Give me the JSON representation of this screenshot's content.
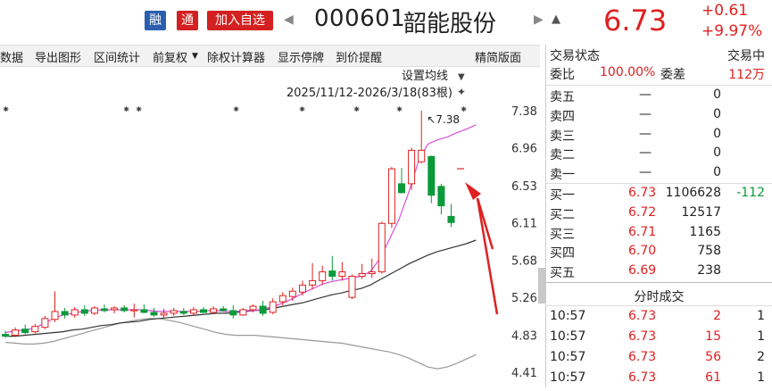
{
  "header": {
    "badge_rong": "融",
    "badge_tong": "通",
    "add_watchlist": "加入自选",
    "code": "000601",
    "name": "韶能股份",
    "price": "6.73",
    "change": "+0.61",
    "change_pct": "+9.97%",
    "nav_prev_icon": "chevron-left-icon",
    "nav_next_icon": "chevron-right-icon",
    "alert_icon": "bell-icon",
    "up_color": "#e02020"
  },
  "toolbar": {
    "items": [
      "数据",
      "导出图形",
      "区间统计",
      "前复权",
      "除权计算器",
      "显示停牌",
      "到价提醒"
    ],
    "restore_dropdown_icon": "caret-down-icon",
    "layout_label": "精简版面"
  },
  "chart": {
    "ma_setting": "设置均线",
    "range_label": "2025/11/12-2026/3/18(83根)",
    "pin_icon": "pin-icon",
    "high_label": "7.38"
  },
  "chart_data": {
    "type": "candlestick",
    "y_ticks": [
      "7.38",
      "6.96",
      "6.53",
      "6.11",
      "5.68",
      "5.26",
      "4.83",
      "4.41"
    ],
    "ylim": [
      4.41,
      7.38
    ],
    "annotated_high": 7.38,
    "candles": [
      {
        "o": 4.84,
        "h": 4.88,
        "l": 4.8,
        "c": 4.82
      },
      {
        "o": 4.83,
        "h": 4.92,
        "l": 4.81,
        "c": 4.89
      },
      {
        "o": 4.9,
        "h": 4.95,
        "l": 4.84,
        "c": 4.86
      },
      {
        "o": 4.87,
        "h": 4.96,
        "l": 4.85,
        "c": 4.93
      },
      {
        "o": 4.92,
        "h": 5.05,
        "l": 4.9,
        "c": 5.02
      },
      {
        "o": 5.01,
        "h": 5.33,
        "l": 4.98,
        "c": 5.1
      },
      {
        "o": 5.1,
        "h": 5.14,
        "l": 5.02,
        "c": 5.06
      },
      {
        "o": 5.06,
        "h": 5.15,
        "l": 5.03,
        "c": 5.12
      },
      {
        "o": 5.12,
        "h": 5.17,
        "l": 5.05,
        "c": 5.08
      },
      {
        "o": 5.08,
        "h": 5.16,
        "l": 5.06,
        "c": 5.14
      },
      {
        "o": 5.13,
        "h": 5.18,
        "l": 5.09,
        "c": 5.11
      },
      {
        "o": 5.12,
        "h": 5.16,
        "l": 5.08,
        "c": 5.14
      },
      {
        "o": 5.14,
        "h": 5.17,
        "l": 5.09,
        "c": 5.11
      },
      {
        "o": 5.11,
        "h": 5.19,
        "l": 5.03,
        "c": 5.12
      },
      {
        "o": 5.12,
        "h": 5.18,
        "l": 5.08,
        "c": 5.09
      },
      {
        "o": 5.09,
        "h": 5.14,
        "l": 5.04,
        "c": 5.06
      },
      {
        "o": 5.06,
        "h": 5.13,
        "l": 5.02,
        "c": 5.08
      },
      {
        "o": 5.08,
        "h": 5.14,
        "l": 5.05,
        "c": 5.11
      },
      {
        "o": 5.1,
        "h": 5.14,
        "l": 5.06,
        "c": 5.08
      },
      {
        "o": 5.08,
        "h": 5.15,
        "l": 5.05,
        "c": 5.12
      },
      {
        "o": 5.12,
        "h": 5.15,
        "l": 5.08,
        "c": 5.09
      },
      {
        "o": 5.09,
        "h": 5.16,
        "l": 5.07,
        "c": 5.13
      },
      {
        "o": 5.13,
        "h": 5.16,
        "l": 5.1,
        "c": 5.11
      },
      {
        "o": 5.11,
        "h": 5.17,
        "l": 5.02,
        "c": 5.06
      },
      {
        "o": 5.06,
        "h": 5.14,
        "l": 5.05,
        "c": 5.12
      },
      {
        "o": 5.12,
        "h": 5.18,
        "l": 5.09,
        "c": 5.16
      },
      {
        "o": 5.16,
        "h": 5.22,
        "l": 5.05,
        "c": 5.08
      },
      {
        "o": 5.09,
        "h": 5.25,
        "l": 5.07,
        "c": 5.21
      },
      {
        "o": 5.21,
        "h": 5.32,
        "l": 5.17,
        "c": 5.28
      },
      {
        "o": 5.27,
        "h": 5.37,
        "l": 5.22,
        "c": 5.33
      },
      {
        "o": 5.32,
        "h": 5.45,
        "l": 5.28,
        "c": 5.4
      },
      {
        "o": 5.4,
        "h": 5.65,
        "l": 5.35,
        "c": 5.45
      },
      {
        "o": 5.45,
        "h": 5.62,
        "l": 5.4,
        "c": 5.55
      },
      {
        "o": 5.56,
        "h": 5.73,
        "l": 5.45,
        "c": 5.5
      },
      {
        "o": 5.5,
        "h": 5.66,
        "l": 5.45,
        "c": 5.55
      },
      {
        "o": 5.26,
        "h": 5.52,
        "l": 5.24,
        "c": 5.5
      },
      {
        "o": 5.5,
        "h": 5.64,
        "l": 5.47,
        "c": 5.53
      },
      {
        "o": 5.53,
        "h": 5.7,
        "l": 5.48,
        "c": 5.55
      },
      {
        "o": 5.55,
        "h": 6.12,
        "l": 5.53,
        "c": 6.1
      },
      {
        "o": 6.1,
        "h": 6.74,
        "l": 6.05,
        "c": 6.72
      },
      {
        "o": 6.55,
        "h": 6.73,
        "l": 6.44,
        "c": 6.45
      },
      {
        "o": 6.55,
        "h": 6.96,
        "l": 6.48,
        "c": 6.93
      },
      {
        "o": 6.8,
        "h": 7.38,
        "l": 6.78,
        "c": 6.93
      },
      {
        "o": 6.86,
        "h": 6.87,
        "l": 6.33,
        "c": 6.42
      },
      {
        "o": 6.52,
        "h": 6.55,
        "l": 6.2,
        "c": 6.3
      },
      {
        "o": 6.18,
        "h": 6.32,
        "l": 6.06,
        "c": 6.11
      }
    ],
    "ma_fast": [
      4.86,
      4.88,
      4.89,
      4.91,
      4.96,
      5.02,
      5.06,
      5.08,
      5.1,
      5.11,
      5.12,
      5.12,
      5.12,
      5.12,
      5.12,
      5.11,
      5.1,
      5.1,
      5.1,
      5.1,
      5.1,
      5.11,
      5.11,
      5.1,
      5.1,
      5.11,
      5.11,
      5.13,
      5.16,
      5.2,
      5.25,
      5.31,
      5.36,
      5.41,
      5.44,
      5.46,
      5.48,
      5.5,
      5.55,
      5.7,
      5.92,
      6.15,
      6.45,
      6.8,
      7.0,
      7.05,
      7.08,
      7.13,
      7.17,
      7.22
    ],
    "ma_slow": [
      4.82,
      4.82,
      4.83,
      4.84,
      4.85,
      4.86,
      4.87,
      4.89,
      4.9,
      4.92,
      4.94,
      4.95,
      4.97,
      4.98,
      4.99,
      5.01,
      5.02,
      5.03,
      5.04,
      5.05,
      5.06,
      5.07,
      5.08,
      5.08,
      5.09,
      5.1,
      5.11,
      5.12,
      5.14,
      5.16,
      5.18,
      5.2,
      5.23,
      5.26,
      5.29,
      5.31,
      5.34,
      5.36,
      5.4,
      5.46,
      5.52,
      5.58,
      5.64,
      5.69,
      5.74,
      5.78,
      5.81,
      5.84,
      5.87,
      5.91
    ],
    "ma_lower": [
      4.75,
      4.74,
      4.73,
      4.73,
      4.74,
      4.76,
      4.79,
      4.82,
      4.85,
      4.88,
      4.91,
      4.94,
      4.97,
      4.99,
      5.01,
      5.02,
      5.02,
      5.0,
      4.98,
      4.95,
      4.92,
      4.89,
      4.86,
      4.84,
      4.83,
      4.83,
      4.83,
      4.82,
      4.81,
      4.8,
      4.79,
      4.78,
      4.77,
      4.76,
      4.75,
      4.74,
      4.72,
      4.7,
      4.68,
      4.66,
      4.64,
      4.61,
      4.57,
      4.52,
      4.47,
      4.45,
      4.47,
      4.51,
      4.56,
      4.61
    ]
  },
  "panel": {
    "status_label": "交易状态",
    "status_value": "交易中",
    "weibi_label": "委比",
    "weibi_value": "100.00%",
    "weicha_label": "委差",
    "weicha_value": "112万",
    "sell": [
      {
        "label": "卖五",
        "price": "—",
        "vol": "0"
      },
      {
        "label": "卖四",
        "price": "—",
        "vol": "0"
      },
      {
        "label": "卖三",
        "price": "—",
        "vol": "0"
      },
      {
        "label": "卖二",
        "price": "—",
        "vol": "0"
      },
      {
        "label": "卖一",
        "price": "—",
        "vol": "0"
      }
    ],
    "buy": [
      {
        "label": "买一",
        "price": "6.73",
        "vol": "1106628",
        "delta": "-112"
      },
      {
        "label": "买二",
        "price": "6.72",
        "vol": "12517",
        "delta": ""
      },
      {
        "label": "买三",
        "price": "6.71",
        "vol": "1165",
        "delta": ""
      },
      {
        "label": "买四",
        "price": "6.70",
        "vol": "758",
        "delta": ""
      },
      {
        "label": "买五",
        "price": "6.69",
        "vol": "238",
        "delta": ""
      }
    ],
    "ticks_title": "分时成交",
    "ticks": [
      {
        "time": "10:57",
        "price": "6.73",
        "vol": "2",
        "n": "1"
      },
      {
        "time": "10:57",
        "price": "6.73",
        "vol": "15",
        "n": "1"
      },
      {
        "time": "10:57",
        "price": "6.73",
        "vol": "56",
        "n": "2"
      },
      {
        "time": "10:57",
        "price": "6.73",
        "vol": "61",
        "n": "1"
      }
    ]
  }
}
